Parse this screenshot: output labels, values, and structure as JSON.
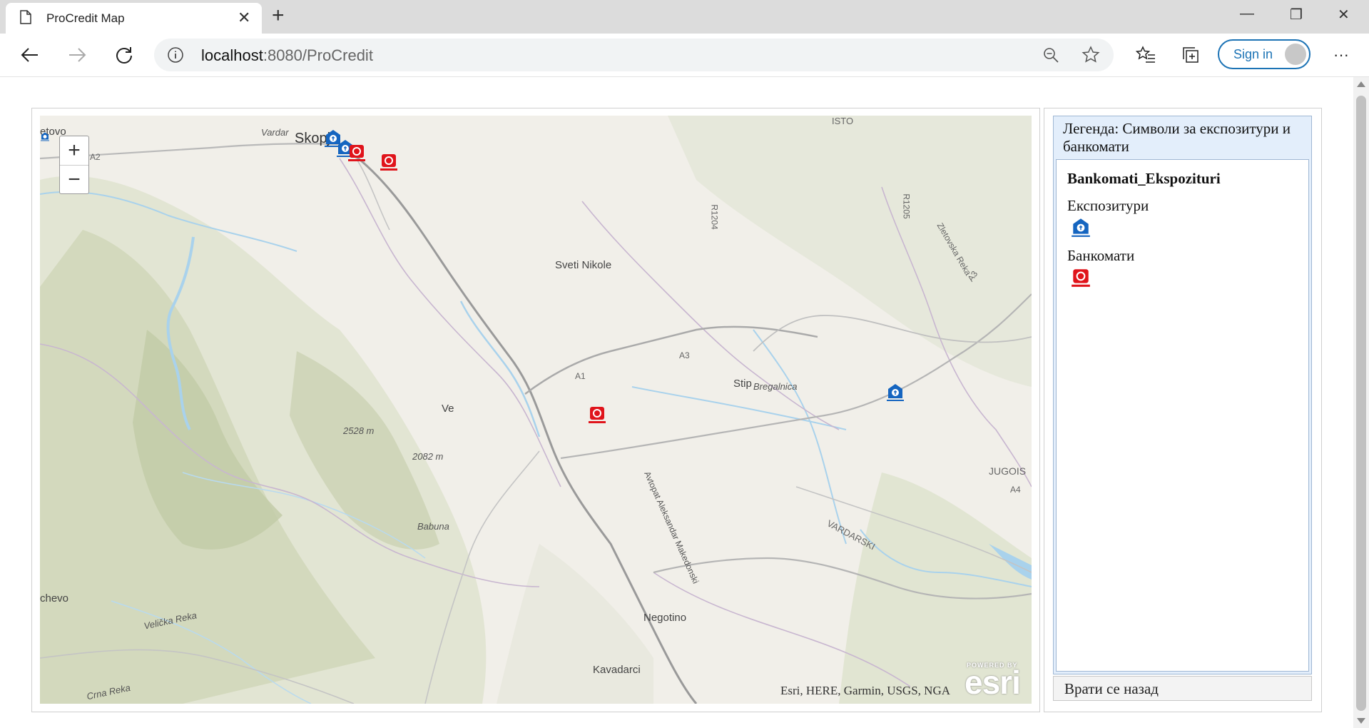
{
  "browser": {
    "tab_title": "ProCredit Map",
    "url_host": "localhost",
    "url_rest": ":8080/ProCredit",
    "sign_in": "Sign in"
  },
  "map": {
    "zoom_in": "+",
    "zoom_out": "−",
    "attribution": "Esri, HERE, Garmin, USGS, NGA",
    "powered_by": "POWERED BY",
    "esri_logo": "esri",
    "labels": {
      "skopje": "Skopje",
      "tetovo": "etovo",
      "sveti_nikole": "Sveti Nikole",
      "stip": "Stip",
      "veles": "Ve",
      "negotino": "Negotino",
      "kavadarci": "Kavadarci",
      "elevation1": "2528 m",
      "elevation2": "2082 m",
      "babuna": "Babuna",
      "vardar": "Vardar",
      "vardarski": "VARDARSKI",
      "bregalnica": "Bregalnica",
      "velicka_reka": "Velička Reka",
      "crna_reka": "Crna Reka",
      "kicevo": "chevo",
      "autopat": "Avtopat Aleksandar Makedonski",
      "zletovska": "Zletovska Reka",
      "a1": "A1",
      "a2": "A2",
      "a3": "A3",
      "a3b": "A3",
      "a4": "A4",
      "r1204": "R1204",
      "r1205": "R1205",
      "jugois": "JUGOIS",
      "isto": "ISTO"
    },
    "markers": [
      {
        "type": "branch",
        "color": "#1565c0"
      },
      {
        "type": "branch",
        "color": "#1565c0"
      },
      {
        "type": "atm",
        "color": "#e0141b"
      },
      {
        "type": "atm",
        "color": "#e0141b"
      },
      {
        "type": "atm",
        "color": "#e0141b"
      },
      {
        "type": "branch",
        "color": "#1565c0"
      },
      {
        "type": "branch",
        "color": "#1565c0"
      }
    ]
  },
  "legend": {
    "title": "Легенда: Символи за експозитури и банкомати",
    "layer": "Bankomati_Ekspozituri",
    "item1": "Експозитури",
    "item2": "Банкомати",
    "color_branch": "#1565c0",
    "color_atm": "#e0141b"
  },
  "back_button": "Врати се назад"
}
